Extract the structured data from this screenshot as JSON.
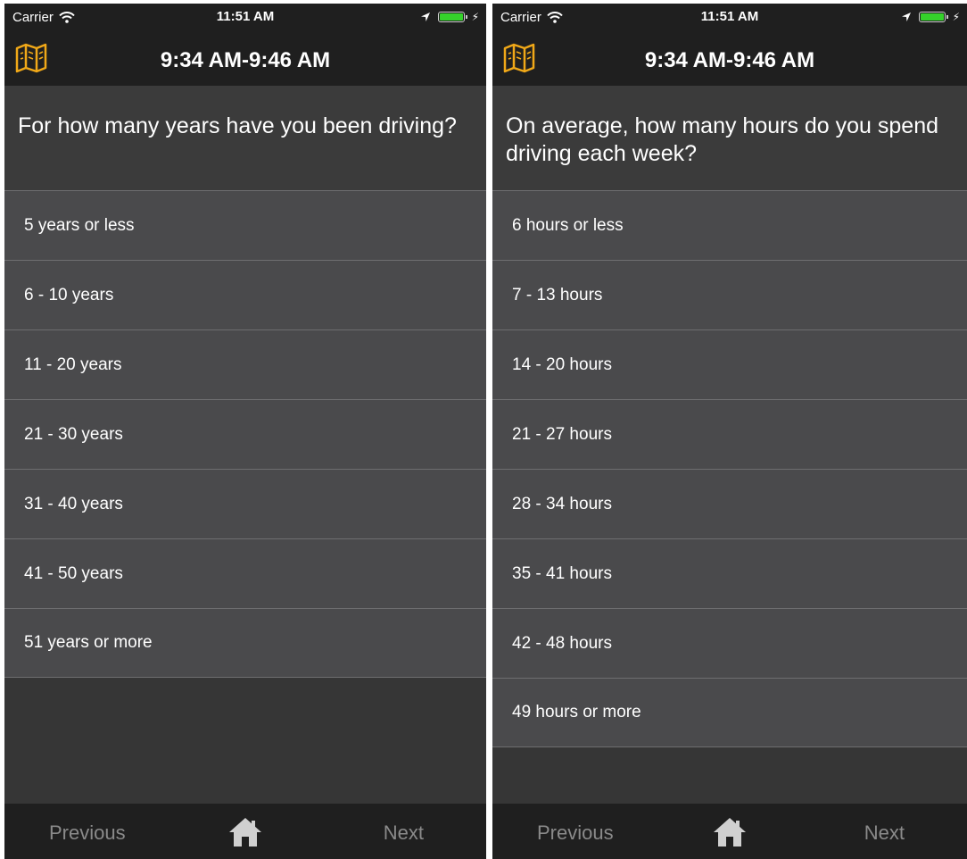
{
  "colors": {
    "accent": "#f0a818",
    "bar_bg": "#1f1f1f",
    "option_bg": "#4a4a4c",
    "muted_text": "#8a8a8a",
    "battery": "#35d22b"
  },
  "icons": {
    "nav": "map-icon",
    "home": "home-icon",
    "wifi": "wifi-icon",
    "location": "location-arrow-icon",
    "battery": "battery-icon"
  },
  "screens": [
    {
      "status": {
        "carrier": "Carrier",
        "time": "11:51 AM"
      },
      "nav": {
        "title": "9:34 AM-9:46 AM"
      },
      "question": "For how many years have you been driving?",
      "options": [
        "5 years or less",
        "6 - 10 years",
        "11 - 20 years",
        "21 - 30 years",
        "31 - 40 years",
        "41 - 50 years",
        "51 years or more"
      ],
      "tabs": {
        "previous": "Previous",
        "next": "Next"
      }
    },
    {
      "status": {
        "carrier": "Carrier",
        "time": "11:51 AM"
      },
      "nav": {
        "title": "9:34 AM-9:46 AM"
      },
      "question": "On average, how many hours do you spend driving each week?",
      "options": [
        "6 hours or less",
        "7 - 13 hours",
        "14 - 20 hours",
        "21 - 27 hours",
        "28 - 34 hours",
        "35 - 41 hours",
        "42 - 48 hours",
        "49 hours or more"
      ],
      "tabs": {
        "previous": "Previous",
        "next": "Next"
      }
    }
  ]
}
